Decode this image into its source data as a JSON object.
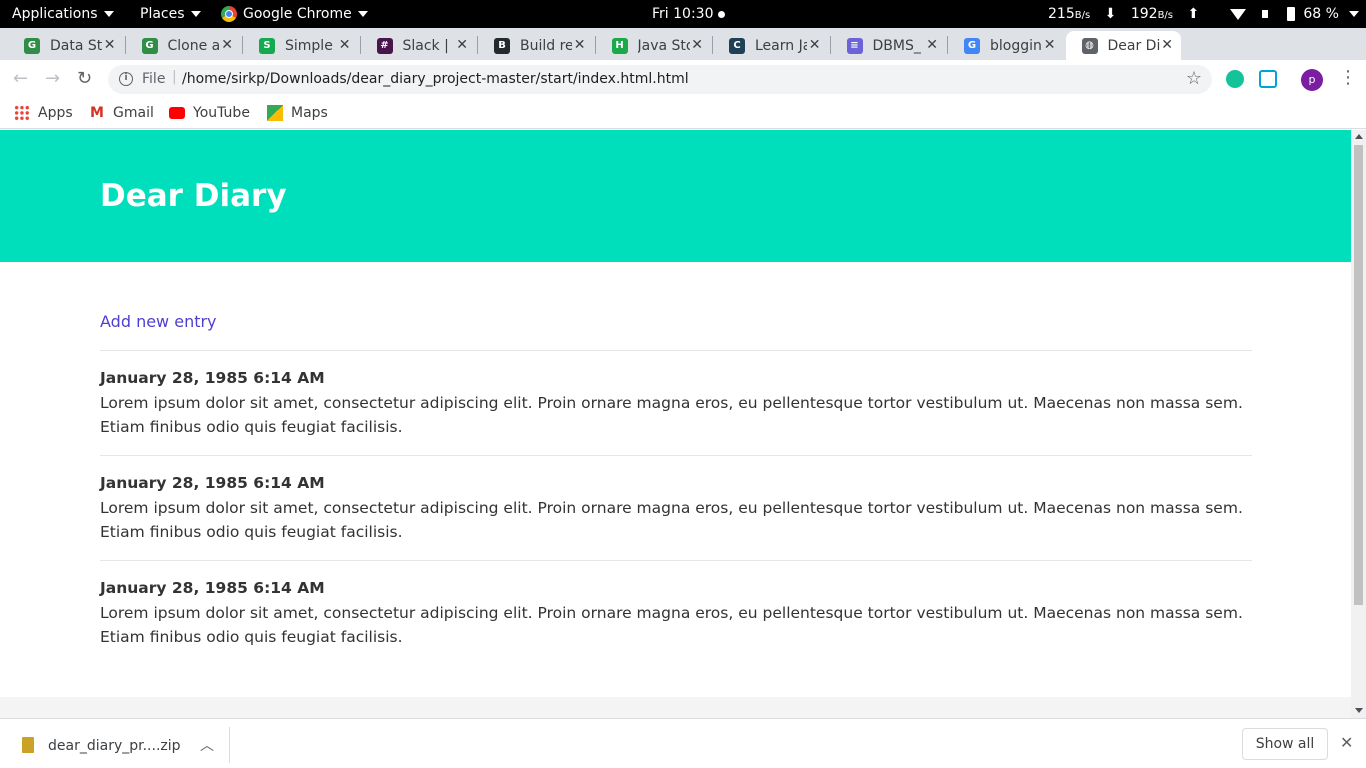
{
  "topbar": {
    "applications": "Applications",
    "places": "Places",
    "app_name": "Google Chrome",
    "clock": "Fri 10:30",
    "net_down_value": "215",
    "net_down_unit": "B/s",
    "net_up_value": "192",
    "net_up_unit": "B/s",
    "down_arrow": "⬇",
    "up_arrow": "⬆",
    "battery": "68 %"
  },
  "tabs": [
    {
      "title": "Data Str",
      "icon": "geeksforgeeks-icon",
      "color": "#2f8d46",
      "glyph": "G"
    },
    {
      "title": "Clone a",
      "icon": "geeksforgeeks-icon",
      "color": "#2f8d46",
      "glyph": "G"
    },
    {
      "title": "Simple",
      "icon": "leaf-icon",
      "color": "#13aa52",
      "glyph": "S"
    },
    {
      "title": "Slack | !",
      "icon": "slack-icon",
      "color": "#4a154b",
      "glyph": "#"
    },
    {
      "title": "Build re",
      "icon": "hexagon-icon",
      "color": "#24292e",
      "glyph": "B"
    },
    {
      "title": "Java Sto",
      "icon": "hackerrank-icon",
      "color": "#1ba94c",
      "glyph": "H"
    },
    {
      "title": "Learn Ja",
      "icon": "codecademy-icon",
      "color": "#1f4056",
      "glyph": "C"
    },
    {
      "title": "DBMS_",
      "icon": "docs-icon",
      "color": "#6c63d9",
      "glyph": "≡"
    },
    {
      "title": "bloggin",
      "icon": "google-icon",
      "color": "#4285f4",
      "glyph": "G"
    },
    {
      "title": "Dear Di",
      "icon": "globe-icon",
      "color": "#5f6368",
      "glyph": "◍"
    }
  ],
  "window": {
    "new_tab": "+",
    "minimize": "–",
    "restore": "⧉",
    "close": "✕",
    "tab_close": "✕"
  },
  "omnibox": {
    "scheme_label": "File",
    "url": "/home/sirkp/Downloads/dear_diary_project-master/start/index.html.html",
    "star": "☆"
  },
  "profile_initial": "p",
  "bookmarks": [
    {
      "label": "Apps",
      "icon": "apps-grid-icon"
    },
    {
      "label": "Gmail",
      "icon": "gmail-icon"
    },
    {
      "label": "YouTube",
      "icon": "youtube-icon"
    },
    {
      "label": "Maps",
      "icon": "maps-icon"
    }
  ],
  "page": {
    "site_title": "Dear Diary",
    "add_entry_link": "Add new entry",
    "entries": [
      {
        "date": "January 28, 1985 6:14 AM",
        "body": "Lorem ipsum dolor sit amet, consectetur adipiscing elit. Proin ornare magna eros, eu pellentesque tortor vestibulum ut. Maecenas non massa sem. Etiam finibus odio quis feugiat facilisis."
      },
      {
        "date": "January 28, 1985 6:14 AM",
        "body": "Lorem ipsum dolor sit amet, consectetur adipiscing elit. Proin ornare magna eros, eu pellentesque tortor vestibulum ut. Maecenas non massa sem. Etiam finibus odio quis feugiat facilisis."
      },
      {
        "date": "January 28, 1985 6:14 AM",
        "body": "Lorem ipsum dolor sit amet, consectetur adipiscing elit. Proin ornare magna eros, eu pellentesque tortor vestibulum ut. Maecenas non massa sem. Etiam finibus odio quis feugiat facilisis."
      }
    ]
  },
  "downloads": {
    "file_name": "dear_diary_pr....zip",
    "show_all": "Show all",
    "close": "✕"
  },
  "colors": {
    "header_accent": "#00dfbb",
    "link": "#4f3fd1"
  }
}
